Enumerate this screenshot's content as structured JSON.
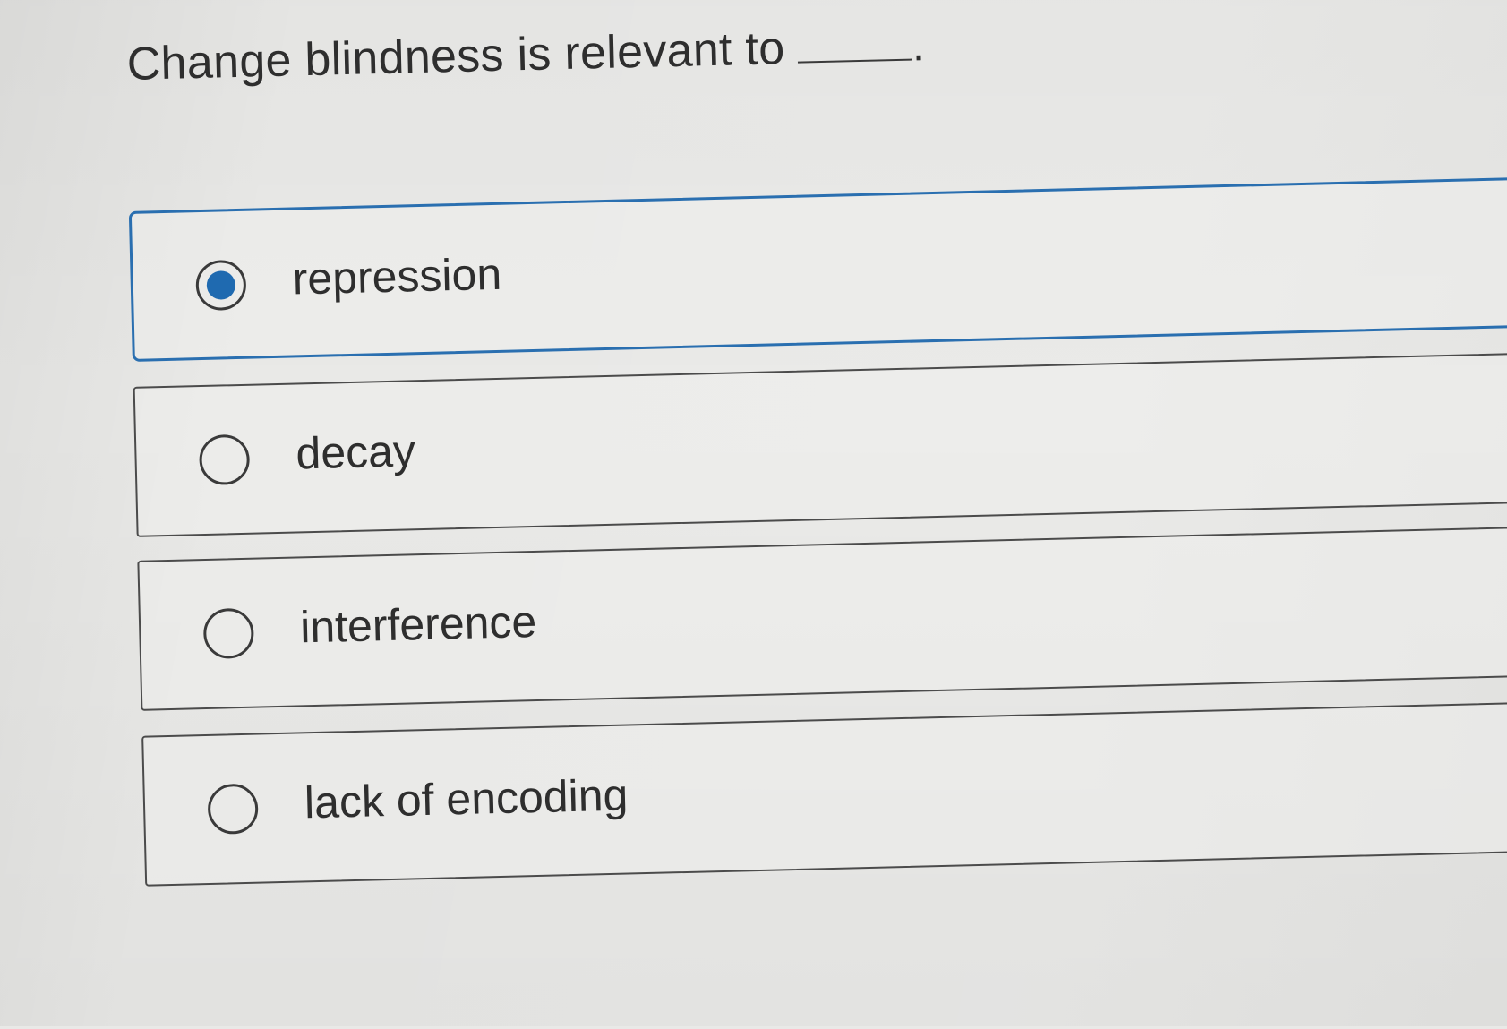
{
  "question": {
    "text": "Change blindness is relevant to",
    "period": "."
  },
  "options": [
    {
      "label": "repression",
      "selected": true
    },
    {
      "label": "decay",
      "selected": false
    },
    {
      "label": "interference",
      "selected": false
    },
    {
      "label": "lack of encoding",
      "selected": false
    }
  ],
  "colors": {
    "accent": "#2a6fb0",
    "radio_fill": "#1f6ab0",
    "text": "#2e2e2e",
    "background": "#e9e9e7"
  },
  "icons": {
    "selected_radio": "radio-selected-icon",
    "unselected_radio": "radio-unselected-icon"
  }
}
